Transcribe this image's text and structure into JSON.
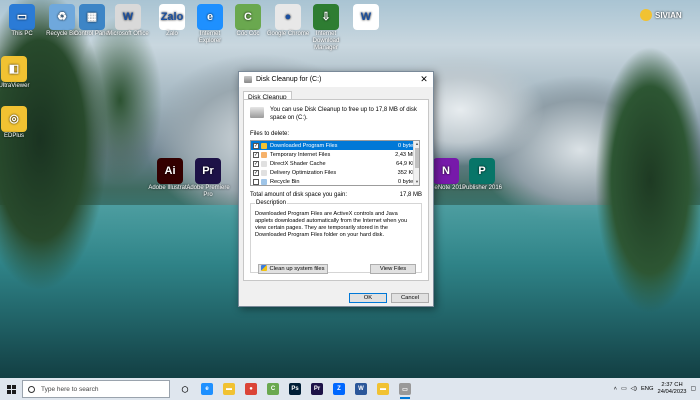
{
  "desktop": {
    "icons": [
      {
        "id": "thispc",
        "label": "This PC",
        "color": "#2b7bd6",
        "glyph": "▭"
      },
      {
        "id": "recyclebin",
        "label": "Recycle Bin",
        "color": "#6fa8dc",
        "glyph": "♻"
      },
      {
        "id": "controlpanel",
        "label": "Control Panel",
        "color": "#3d85c6",
        "glyph": "▦"
      },
      {
        "id": "msoffice",
        "label": "Microsoft Office",
        "color": "#d9d9d9",
        "glyph": "W"
      },
      {
        "id": "zalo",
        "label": "Zalo",
        "color": "#ffffff",
        "glyph": "Zalo"
      },
      {
        "id": "ie",
        "label": "Internet Explorer",
        "color": "#1e90ff",
        "glyph": "e"
      },
      {
        "id": "coccoc",
        "label": "Cốc Cốc",
        "color": "#6aa84f",
        "glyph": "C"
      },
      {
        "id": "chrome",
        "label": "Google Chrome",
        "color": "#e8e8e8",
        "glyph": "●"
      },
      {
        "id": "idm",
        "label": "Internet Download Manager",
        "color": "#2e7d32",
        "glyph": "⇩"
      },
      {
        "id": "word",
        "label": "",
        "color": "#ffffff",
        "glyph": "W"
      },
      {
        "id": "ultraviewer",
        "label": "UltraViewer",
        "color": "#f1c232",
        "glyph": "◧"
      },
      {
        "id": "eduplus",
        "label": "EDPlus",
        "color": "#f1c232",
        "glyph": "◎"
      },
      {
        "id": "illustrator",
        "label": "Adobe Illustrat...",
        "color": "#330000",
        "glyph": "Ai"
      },
      {
        "id": "premiere",
        "label": "Adobe Premiere Pro",
        "color": "#1d1247",
        "glyph": "Pr"
      },
      {
        "id": "onenote",
        "label": "OneNote 2016",
        "color": "#7719aa",
        "glyph": "N"
      },
      {
        "id": "publisher",
        "label": "Publisher 2016",
        "color": "#077568",
        "glyph": "P"
      }
    ],
    "brand_logo_text": "SIVIAN"
  },
  "dialog": {
    "title": "Disk Cleanup for  (C:)",
    "close_glyph": "✕",
    "tab_label": "Disk Cleanup",
    "intro": "You can use Disk Cleanup to free up to 17,8 MB of disk space on  (C:).",
    "files_to_delete_label": "Files to delete:",
    "files": [
      {
        "name": "Downloaded Program Files",
        "size": "0 bytes",
        "checked": true,
        "selected": true,
        "icon_color": "#f1c232"
      },
      {
        "name": "Temporary Internet Files",
        "size": "2,43 MB",
        "checked": true,
        "selected": false,
        "icon_color": "#f6b26b"
      },
      {
        "name": "DirectX Shader Cache",
        "size": "64,9 KB",
        "checked": true,
        "selected": false,
        "icon_color": "#e0e0e0"
      },
      {
        "name": "Delivery Optimization Files",
        "size": "352 KB",
        "checked": true,
        "selected": false,
        "icon_color": "#e0e0e0"
      },
      {
        "name": "Recycle Bin",
        "size": "0 bytes",
        "checked": false,
        "selected": false,
        "icon_color": "#9fc5e8"
      }
    ],
    "total_label": "Total amount of disk space you gain:",
    "total_value": "17,8 MB",
    "description_legend": "Description",
    "description": "Downloaded Program Files are ActiveX controls and Java applets downloaded automatically from the Internet when you view certain pages. They are temporarily stored in the Downloaded Program Files folder on your hard disk.",
    "cleanup_system_label": "Clean up system files",
    "view_files_label": "View Files",
    "ok_label": "OK",
    "cancel_label": "Cancel"
  },
  "taskbar": {
    "search_placeholder": "Type here to search",
    "apps": [
      {
        "id": "taskview",
        "glyph": "◯",
        "color": "#ffffff",
        "active": false
      },
      {
        "id": "ie",
        "glyph": "e",
        "color": "#1e90ff",
        "active": false
      },
      {
        "id": "explorer",
        "glyph": "▬",
        "color": "#f1c232",
        "active": false
      },
      {
        "id": "chrome",
        "glyph": "●",
        "color": "#db4437",
        "active": false
      },
      {
        "id": "coccoc",
        "glyph": "C",
        "color": "#6aa84f",
        "active": false
      },
      {
        "id": "photoshop",
        "glyph": "Ps",
        "color": "#001e36",
        "active": false
      },
      {
        "id": "premiere",
        "glyph": "Pr",
        "color": "#1d1247",
        "active": false
      },
      {
        "id": "zalo",
        "glyph": "Z",
        "color": "#0068ff",
        "active": false
      },
      {
        "id": "word",
        "glyph": "W",
        "color": "#2b579a",
        "active": false
      },
      {
        "id": "explorer2",
        "glyph": "▬",
        "color": "#f1c232",
        "active": false
      },
      {
        "id": "diskcleanup",
        "glyph": "▭",
        "color": "#999999",
        "active": true
      }
    ],
    "language": "ENG",
    "time": "2:37 CH",
    "date": "24/04/2023"
  }
}
